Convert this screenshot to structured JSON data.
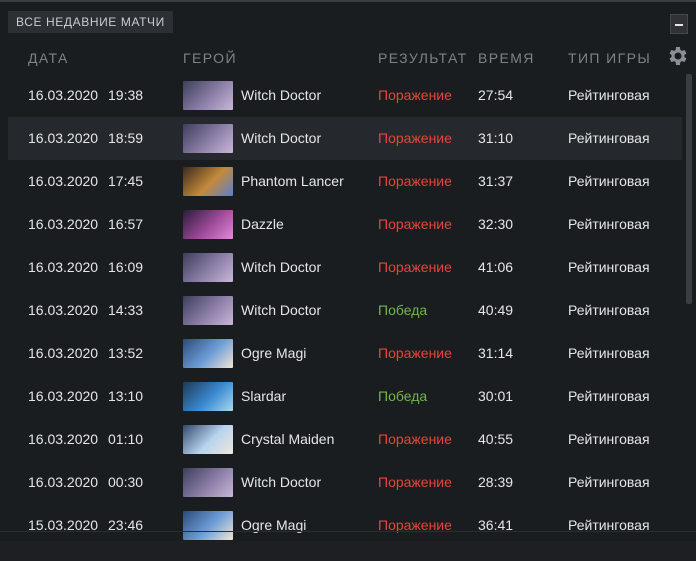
{
  "panel": {
    "tab_title": "ВСЕ НЕДАВНИЕ МАТЧИ",
    "minimize_icon": "minus-icon",
    "settings_icon": "gear-icon"
  },
  "columns": {
    "date": "ДАТА",
    "hero": "ГЕРОЙ",
    "result": "РЕЗУЛЬТАТ",
    "duration": "ВРЕМЯ",
    "mode": "ТИП ИГРЫ"
  },
  "colors": {
    "loss": "#e2473a",
    "win": "#74b54b",
    "row_highlight": "#25292d"
  },
  "matches": [
    {
      "date": "16.03.2020",
      "time": "19:38",
      "hero": "Witch Doctor",
      "result": "Поражение",
      "outcome": "loss",
      "duration": "27:54",
      "mode": "Рейтинговая"
    },
    {
      "date": "16.03.2020",
      "time": "18:59",
      "hero": "Witch Doctor",
      "result": "Поражение",
      "outcome": "loss",
      "duration": "31:10",
      "mode": "Рейтинговая"
    },
    {
      "date": "16.03.2020",
      "time": "17:45",
      "hero": "Phantom Lancer",
      "result": "Поражение",
      "outcome": "loss",
      "duration": "31:37",
      "mode": "Рейтинговая"
    },
    {
      "date": "16.03.2020",
      "time": "16:57",
      "hero": "Dazzle",
      "result": "Поражение",
      "outcome": "loss",
      "duration": "32:30",
      "mode": "Рейтинговая"
    },
    {
      "date": "16.03.2020",
      "time": "16:09",
      "hero": "Witch Doctor",
      "result": "Поражение",
      "outcome": "loss",
      "duration": "41:06",
      "mode": "Рейтинговая"
    },
    {
      "date": "16.03.2020",
      "time": "14:33",
      "hero": "Witch Doctor",
      "result": "Победа",
      "outcome": "win",
      "duration": "40:49",
      "mode": "Рейтинговая"
    },
    {
      "date": "16.03.2020",
      "time": "13:52",
      "hero": "Ogre Magi",
      "result": "Поражение",
      "outcome": "loss",
      "duration": "31:14",
      "mode": "Рейтинговая"
    },
    {
      "date": "16.03.2020",
      "time": "13:10",
      "hero": "Slardar",
      "result": "Победа",
      "outcome": "win",
      "duration": "30:01",
      "mode": "Рейтинговая"
    },
    {
      "date": "16.03.2020",
      "time": "01:10",
      "hero": "Crystal Maiden",
      "result": "Поражение",
      "outcome": "loss",
      "duration": "40:55",
      "mode": "Рейтинговая"
    },
    {
      "date": "16.03.2020",
      "time": "00:30",
      "hero": "Witch Doctor",
      "result": "Поражение",
      "outcome": "loss",
      "duration": "28:39",
      "mode": "Рейтинговая"
    },
    {
      "date": "15.03.2020",
      "time": "23:46",
      "hero": "Ogre Magi",
      "result": "Поражение",
      "outcome": "loss",
      "duration": "36:41",
      "mode": "Рейтинговая"
    }
  ]
}
